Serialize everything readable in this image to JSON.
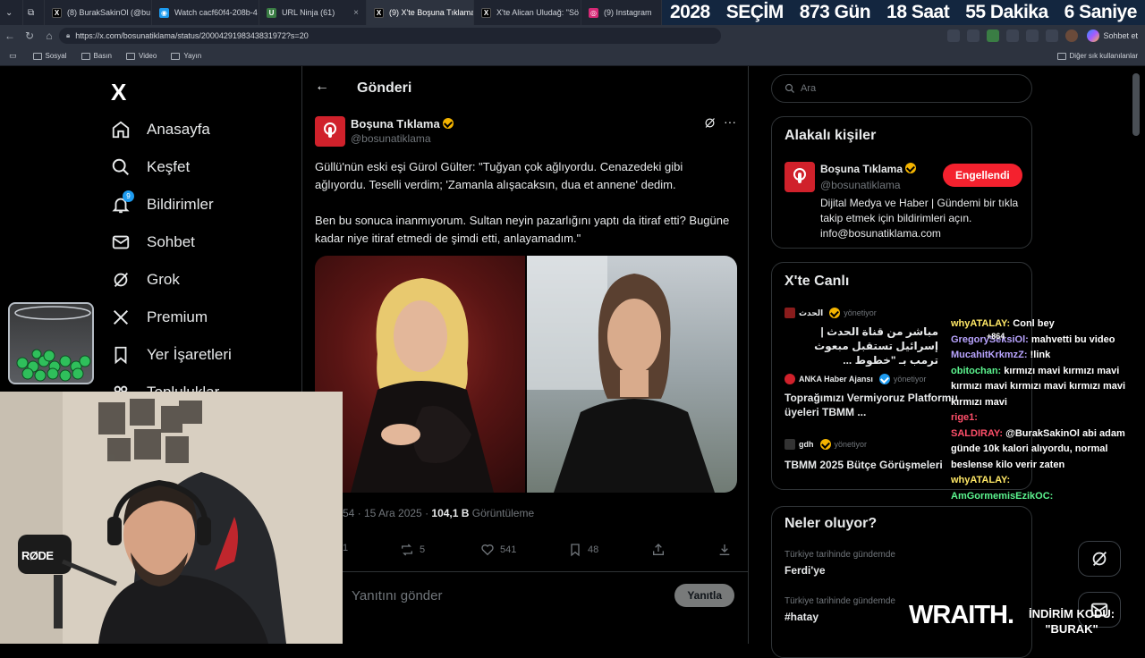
{
  "browser": {
    "tabs": [
      {
        "label": "(8) BurakSakinOl (@bu",
        "favicon": "x",
        "color": "#000000"
      },
      {
        "label": "Watch cacf60f4-208b-4",
        "favicon": "w",
        "color": "#1d9bf0"
      },
      {
        "label": "URL Ninja (61)",
        "favicon": "u",
        "color": "#3a7d44"
      },
      {
        "label": "(9) X'te Boşuna Tıklama",
        "favicon": "x",
        "color": "#000000",
        "active": true
      },
      {
        "label": "X'te Alican Uludağ: \"Sö",
        "favicon": "x",
        "color": "#000000"
      },
      {
        "label": "(9) Instagram",
        "favicon": "i",
        "color": "#d62976"
      }
    ],
    "url": "https://x.com/bosunatiklama/status/2000429198343831972?s=20",
    "profile_button": "Sohbet et",
    "bookmarks": [
      "Sosyal",
      "Basın",
      "Video",
      "Yayın"
    ],
    "other_bookmarks": "Diğer sık kullanılanlar"
  },
  "countdown": {
    "year": "2028",
    "label": "SEÇİM",
    "days": "873 Gün",
    "hours": "18 Saat",
    "minutes": "55 Dakika",
    "seconds": "6 Saniye"
  },
  "nav": {
    "logo": "X",
    "items": [
      {
        "label": "Anasayfa",
        "icon": "home-icon"
      },
      {
        "label": "Keşfet",
        "icon": "search-icon"
      },
      {
        "label": "Bildirimler",
        "icon": "bell-icon",
        "badge": "9"
      },
      {
        "label": "Sohbet",
        "icon": "mail-icon"
      },
      {
        "label": "Grok",
        "icon": "grok-icon"
      },
      {
        "label": "Premium",
        "icon": "x-icon"
      },
      {
        "label": "Yer İşaretleri",
        "icon": "bookmark-icon"
      },
      {
        "label": "Topluluklar",
        "icon": "people-icon"
      }
    ]
  },
  "post": {
    "header": "Gönderi",
    "author_name": "Boşuna Tıklama",
    "author_handle": "@bosunatiklama",
    "text_p1": "Güllü'nün eski eşi Gürol Gülter: \"Tuğyan çok ağlıyordu. Cenazedeki gibi ağlıyordu. Teselli verdim; 'Zamanla alışacaksın, dua et annene' dedim.",
    "text_p2": "Ben bu sonuca inanmıyorum. Sultan neyin pazarlığını yaptı da itiraf etti? Bugüne kadar niye itiraf etmedi de şimdi etti, anlayamadım.\"",
    "time": "54 · 15 Ara 2025 · ",
    "views": "104,1 B",
    "views_label": " Görüntüleme",
    "replies": "1",
    "reposts": "5",
    "likes": "541",
    "bookmarks": "48",
    "reply_placeholder": "Yanıtını gönder",
    "reply_button": "Yanıtla"
  },
  "sidebar": {
    "search_placeholder": "Ara",
    "related_title": "Alakalı kişiler",
    "related_name": "Boşuna Tıklama",
    "related_handle": "@bosunatiklama",
    "related_bio": "Dijital Medya ve Haber | Gündemi bir tıkla takip etmek için bildirimleri açın. info@bosunatiklama.com",
    "follow_button": "Engellendi",
    "live_title": "X'te Canlı",
    "live": [
      {
        "host": "الحدث",
        "status": "yönetiyor",
        "title": "مباشر من قناة الحدث | إسرائيل تستقبل مبعوث ترمب بـ \"خطوط ..."
      },
      {
        "host": "ANKA Haber Ajansı",
        "status": "yönetiyor",
        "title": "Toprağımızı Vermiyoruz Platformu üyeleri TBMM ..."
      },
      {
        "host": "gdh",
        "status": "yönetiyor",
        "title": "TBMM 2025 Bütçe Görüşmeleri"
      }
    ],
    "trends_title": "Neler oluyor?",
    "trends": [
      {
        "context": "Türkiye tarihinde gündemde",
        "name": "Ferdi'ye"
      },
      {
        "context": "Türkiye tarihinde gündemde",
        "name": "#hatay"
      }
    ]
  },
  "chat": [
    {
      "user": "whyATALAY:",
      "msg": "Conl bey",
      "cls": "u1"
    },
    {
      "user": "GregorySeksiOl:",
      "msg": "mahvetti bu video",
      "cls": "u1"
    },
    {
      "user": "MucahitKrkmzZ:",
      "msg": "!link",
      "cls": "u3"
    },
    {
      "user": "obitochan:",
      "msg": "kırmızı mavi kırmızı mavi kırmızı mavi kırmızı mavi kırmızı mavi kırmızı mavi",
      "cls": "u4"
    },
    {
      "user": "rige1:",
      "msg": "",
      "cls": "u5"
    },
    {
      "user": "SALDIRAY:",
      "msg": "@BurakSakinOl abi adam günde 10k kalori alıyordu, normal beslense kilo verir zaten",
      "cls": "u5"
    },
    {
      "user": "whyATALAY:",
      "msg": "",
      "cls": "u1"
    },
    {
      "user": "AmGormemisEzikOC:",
      "msg": "",
      "cls": "u4"
    }
  ],
  "overlay": {
    "badge_count": "+864",
    "brand": "WRAITH.",
    "promo_line1": "İNDİRİM KODU:",
    "promo_line2": "\"BURAK\"",
    "mic_brand": "RØDE"
  }
}
